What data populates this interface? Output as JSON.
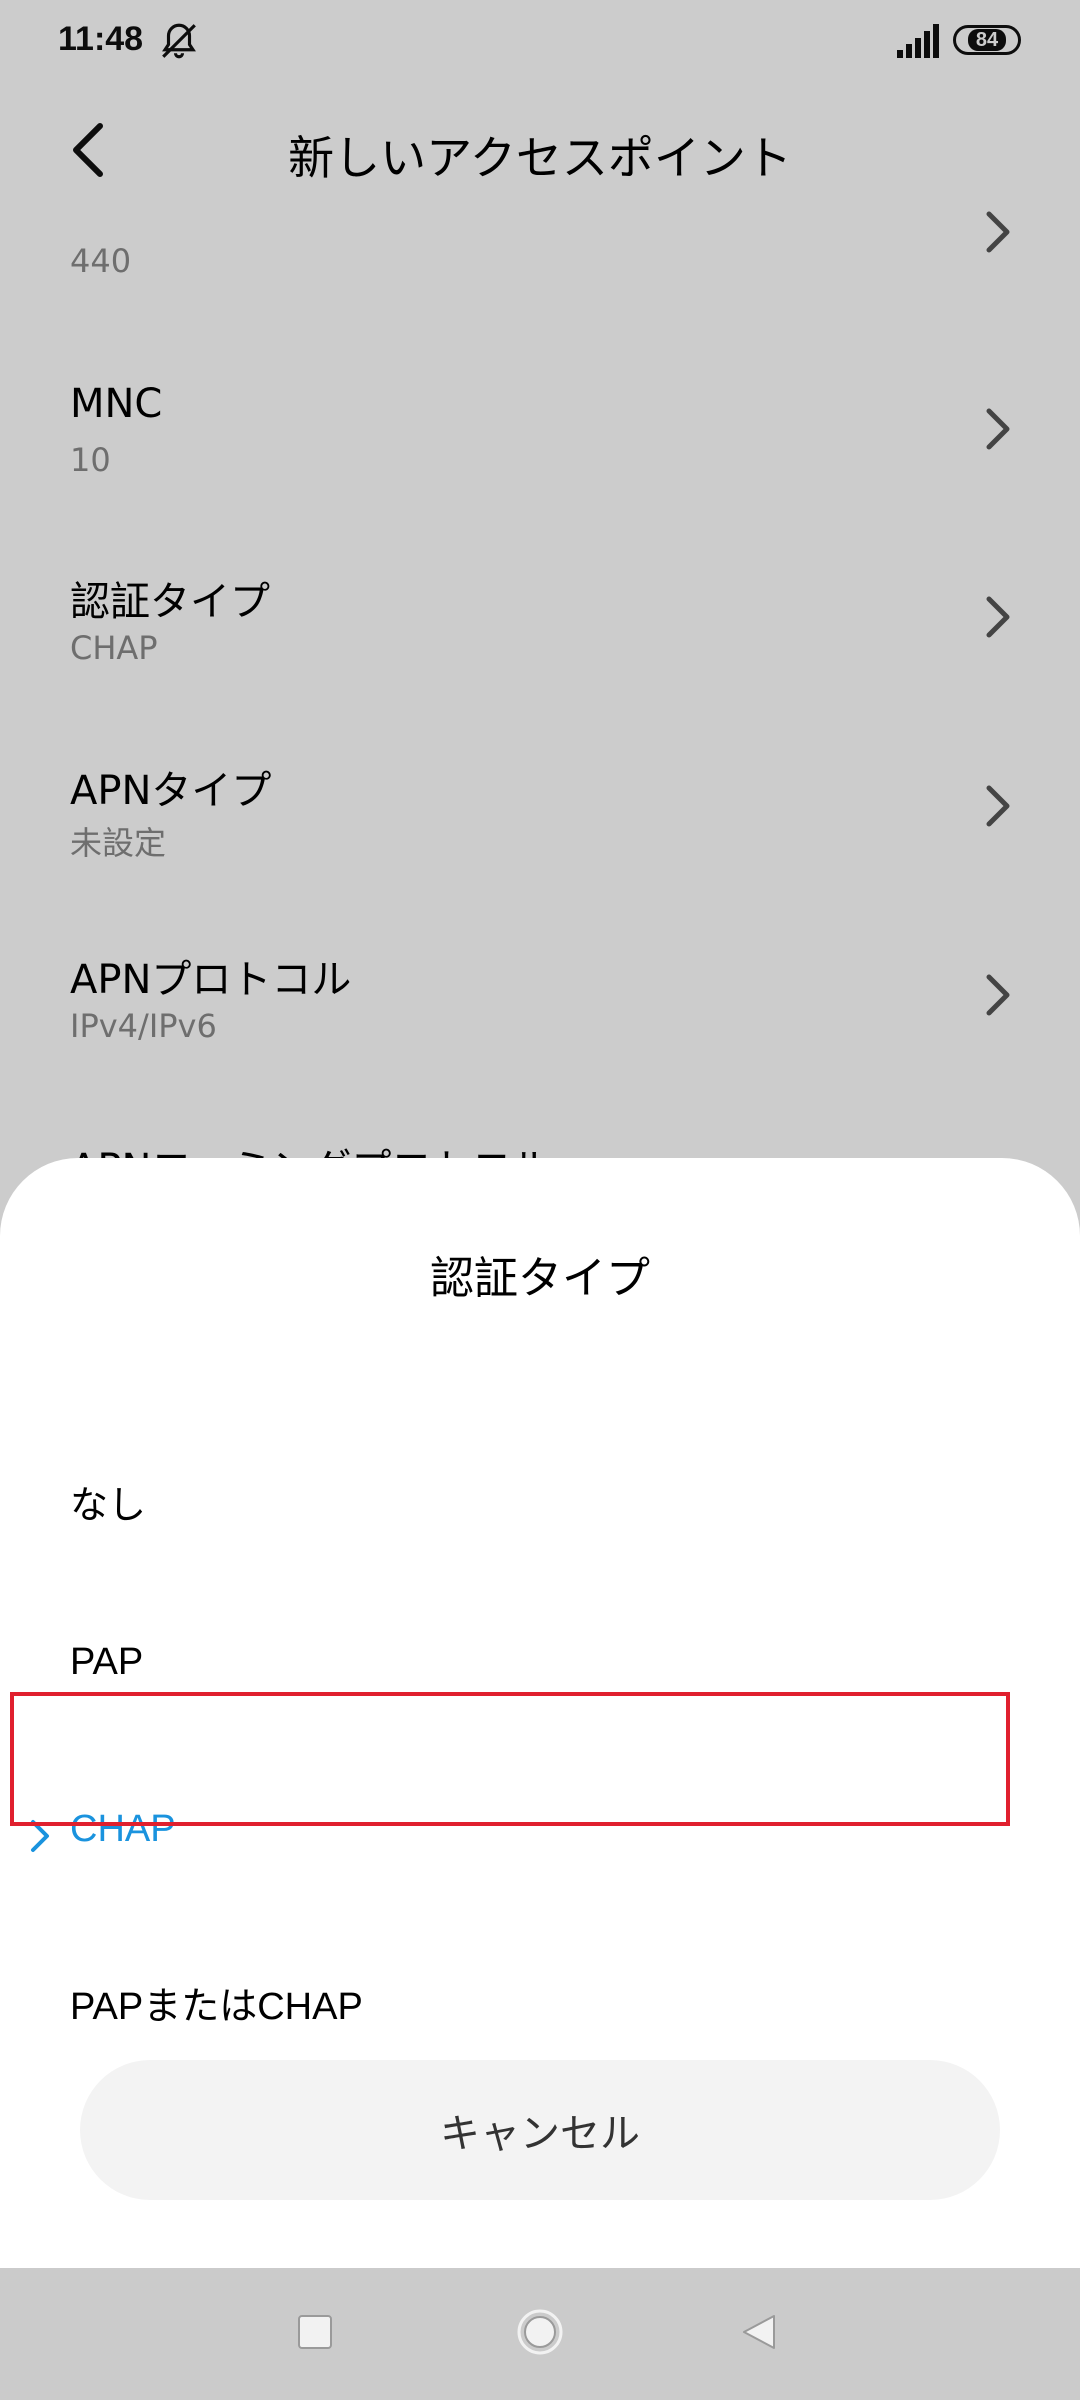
{
  "status_bar": {
    "time": "11:48",
    "battery": "84",
    "icons": [
      "alarm-off-icon",
      "signal-icon",
      "battery-icon"
    ]
  },
  "header": {
    "title": "新しいアクセスポイント",
    "back_icon": "back-arrow-icon"
  },
  "settings": {
    "items": [
      {
        "label": "",
        "value": "440"
      },
      {
        "label": "MNC",
        "value": "10"
      },
      {
        "label": "認証タイプ",
        "value": "CHAP"
      },
      {
        "label": "APNタイプ",
        "value": "未設定"
      },
      {
        "label": "APNプロトコル",
        "value": "IPv4/IPv6"
      },
      {
        "label": "APNローミングプロトコル",
        "value": ""
      }
    ]
  },
  "sheet": {
    "title": "認証タイプ",
    "options": [
      "なし",
      "PAP",
      "CHAP",
      "PAPまたはCHAP"
    ],
    "selected": "CHAP",
    "cancel_label": "キャンセル"
  },
  "colors": {
    "accent": "#1a93de",
    "highlight": "#e0202e"
  },
  "nav_bar": {
    "icons": [
      "recent-apps-icon",
      "home-icon",
      "back-icon"
    ]
  }
}
